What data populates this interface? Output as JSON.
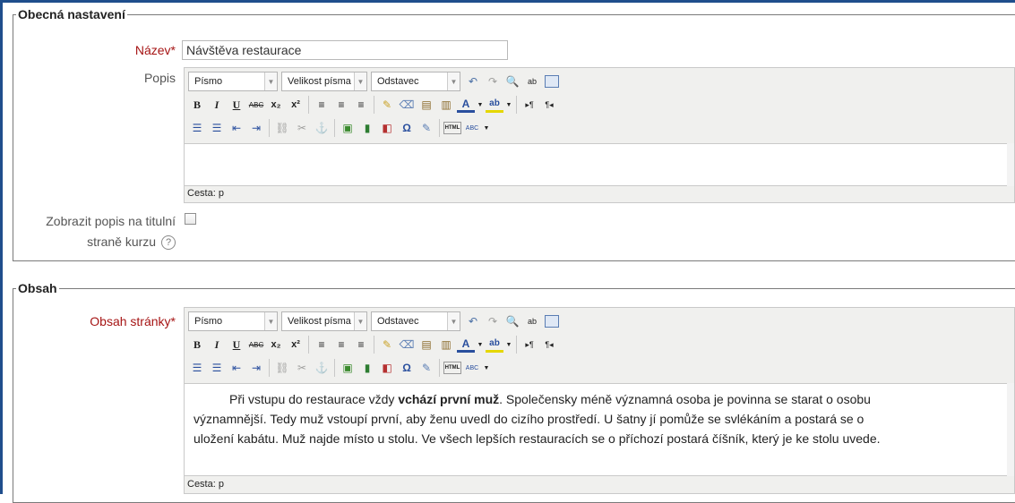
{
  "general": {
    "legend": "Obecná nastavení",
    "name_label": "Název",
    "required_mark": "*",
    "name_value": "Návštěva restaurace",
    "description_label": "Popis",
    "show_desc_label_line1": "Zobrazit popis na titulní",
    "show_desc_label_line2": "straně kurzu",
    "help_icon": "?"
  },
  "toolbar": {
    "font_select": "Písmo",
    "size_select": "Velikost písma",
    "format_select": "Odstavec",
    "row1_icons": [
      "undo-icon",
      "redo-icon",
      "find-icon",
      "replace-icon",
      "fullscreen-icon"
    ],
    "row2_icons": [
      "bold-icon",
      "italic-icon",
      "underline-icon",
      "strikethrough-icon",
      "subscript-icon",
      "superscript-icon",
      "align-left-icon",
      "align-center-icon",
      "align-right-icon",
      "cleanup-icon",
      "eraser-icon",
      "paste-text-icon",
      "paste-word-icon",
      "text-color-icon",
      "highlight-icon",
      "ltr-icon",
      "rtl-icon"
    ],
    "row3_icons": [
      "bullet-list-icon",
      "numbered-list-icon",
      "outdent-icon",
      "indent-icon",
      "link-icon",
      "unlink-icon",
      "anchor-icon",
      "image-icon",
      "media-icon",
      "moodle-media-icon",
      "special-char-icon",
      "edit-icon",
      "html-icon",
      "spellcheck-icon"
    ],
    "glyphs": {
      "bold": "B",
      "italic": "I",
      "underline": "U",
      "strike": "ABC",
      "sub": "x₂",
      "sup": "x²",
      "omega": "Ω",
      "html": "HTML",
      "spell": "ABC",
      "ltr": "▸¶",
      "rtl": "¶◂",
      "color_a": "A",
      "hl": "ab"
    }
  },
  "description_editor": {
    "path_label": "Cesta: p",
    "content": ""
  },
  "content_section": {
    "legend": "Obsah",
    "label": "Obsah stránky",
    "required_mark": "*",
    "path_label": "Cesta: p",
    "para_before": "Při vstupu do restaurace vždy ",
    "para_bold": "vchází první muž",
    "para_after": ". Společensky méně významná osoba je povinna se starat o osobu",
    "line2": "významnější. Tedy muž vstoupí první, aby ženu uvedl do cizího prostředí. U šatny jí pomůže se svlékáním a postará se o",
    "line3": "uložení kabátu. Muž najde místo u stolu. Ve všech lepších restauracích se o příchozí postará číšník, který je ke stolu uvede."
  },
  "colors": {
    "required": "#a61515",
    "frame": "#1f4e8c",
    "editor_bg": "#f0f0ee"
  }
}
